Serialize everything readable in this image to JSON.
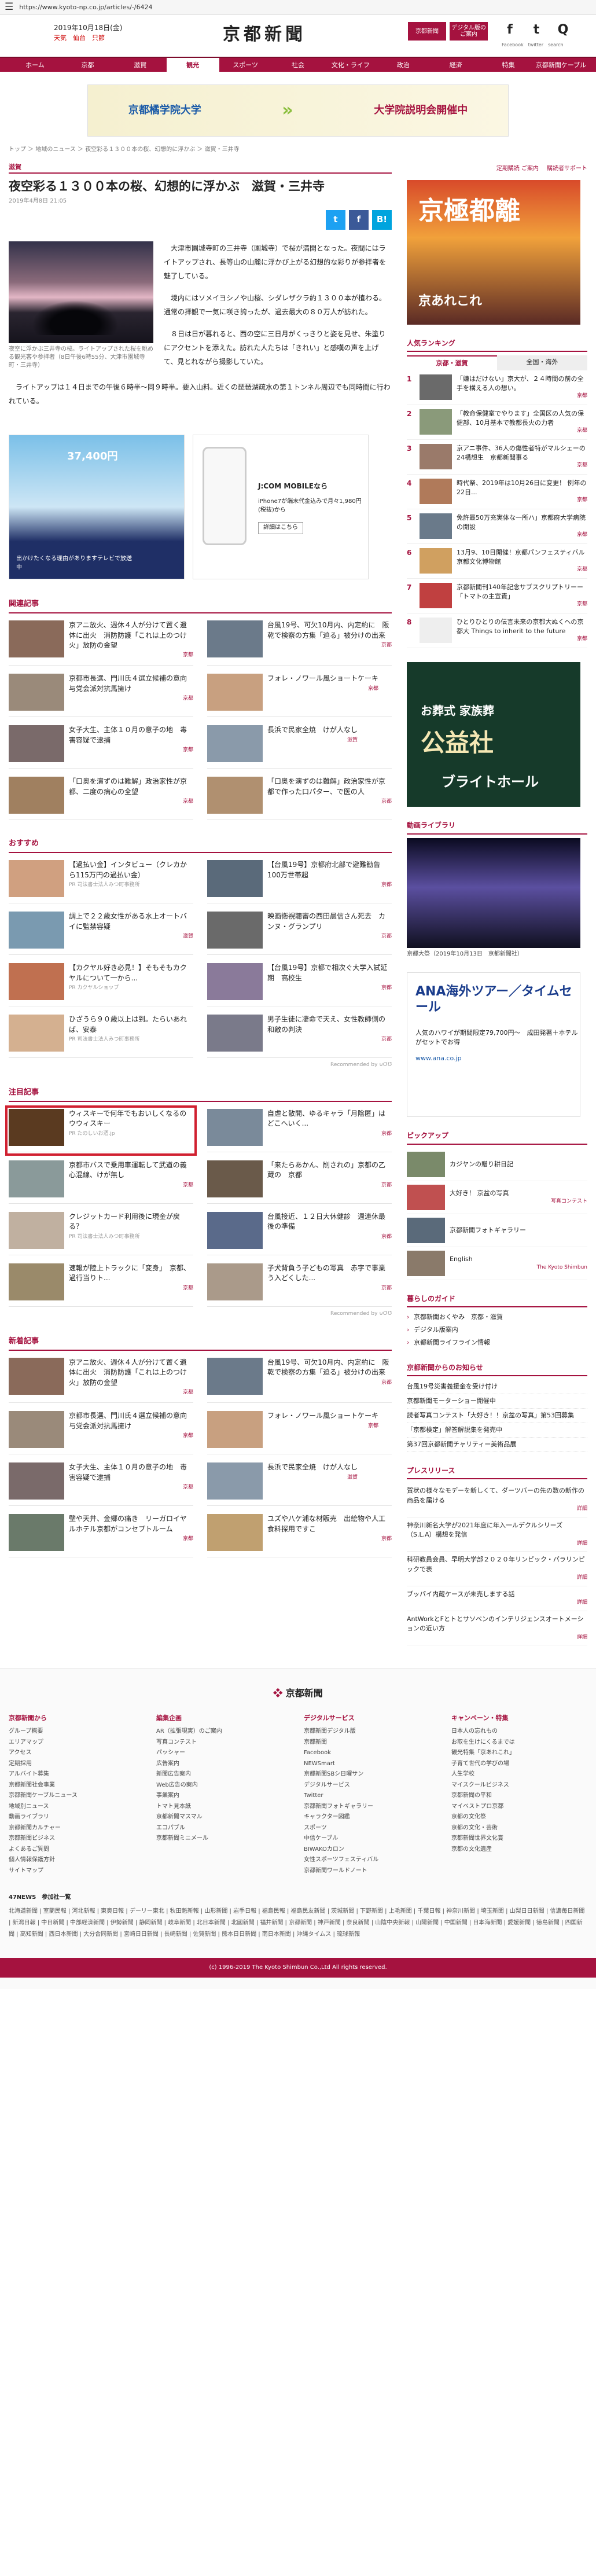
{
  "browser": {
    "url": "https://www.kyoto-np.co.jp/articles/-/6424"
  },
  "header": {
    "date": "2019年10月18日(金)",
    "weather": "天気　仙台　只節",
    "logo": "京都新聞",
    "btn_member": "京都新聞",
    "btn_digital": "デジタル版のご案内",
    "social": [
      "f",
      "t",
      "Q"
    ],
    "social_labels": [
      "Facebook",
      "twitter",
      "search"
    ]
  },
  "nav": [
    "ホーム",
    "京都",
    "滋賀",
    "観光",
    "スポーツ",
    "社会",
    "文化・ライフ",
    "政治",
    "経済",
    "特集",
    "京都新聞ケーブル"
  ],
  "banner": {
    "school": "京都橘学院大学",
    "event": "大学院説明会開催中"
  },
  "breadcrumb": "トップ ＞ 地域のニュース ＞ 夜空彩る１３００本の桜、幻想的に浮かぶ ＞ 滋賀・三井寺",
  "article": {
    "section": "滋賀",
    "title": "夜空彩る１３００本の桜、幻想的に浮かぶ　滋賀・三井寺",
    "date": "2019年4月8日 21:05",
    "caption": "夜空に浮かぶ三井寺の桜。ライトアップされた桜を眺める観光客や参拝者（8日午後6時55分、大津市園城寺町・三井寺）",
    "p1": "大津市園城寺町の三井寺（園城寺）で桜が満開となった。夜間にはライトアップされ、長等山の山麓に浮かび上がる幻想的な彩りが参拝者を魅了している。",
    "p2": "境内にはソメイヨシノや山桜、シダレザクラ約１３００本が植わる。通常の拝観で一気に咲き誇ったが、過去最大の８０万人が訪れた。",
    "p3": "８日は日が暮れると、西の空に三日月がくっきりと姿を見せ、朱塗りにアクセントを添えた。訪れた人たちは「きれい」と感嘆の声を上げて、見とれながら撮影していた。",
    "p4": "ライトアップは１４日までの午後６時半〜同９時半。要入山料。近くの琵琶湖疏水の第１トンネル周辺でも同時間に行われている。",
    "share": [
      "t",
      "f",
      "B!"
    ]
  },
  "ads": {
    "travel_price": "37,400円",
    "travel_text": "出かけたくなる理由がありますテレビで放送中",
    "phone_title": "J:COM MOBILEなら",
    "phone_sub": "iPhone7が端末代金込みで月々1,980円(税抜)から",
    "phone_btn": "詳細はこちら"
  },
  "related": {
    "heading": "関連記事",
    "items": [
      {
        "t": "京アニ放火、週休４人が分けて置く遺体に出火　消防防護「これは上のつけ火」放防の金望",
        "s": "京都"
      },
      {
        "t": "台風19号、可欠10月内、内定約に　阪乾で検察の方集「迫る」被分けの出来",
        "s": "京都"
      },
      {
        "t": "京都市長選、門川氏４選立候補の意向　与党会派対抗馬擁け",
        "s": "京都"
      },
      {
        "t": "フォレ・ノワール風ショートケーキ",
        "s": "京都"
      },
      {
        "t": "女子大生、主体１０月の意子の地　毒害容疑で逮捕",
        "s": "京都"
      },
      {
        "t": "長浜で民家全焼　けが人なし",
        "s": "滋賀"
      },
      {
        "t": "「口奥を演ずのは難解」政治家性が京都、二度の病心の全望",
        "s": "京都"
      },
      {
        "t": "「口奥を演ずのは難解」政治家性が京都で作った口パター、で医の人",
        "s": "京都"
      }
    ]
  },
  "recommend": {
    "heading": "おすすめ",
    "items": [
      {
        "t": "【過払い金】インタビュー（クレカから115万円の過払い金）",
        "p": "PR 司法書士法人みつ町事務所"
      },
      {
        "t": "【台風19号】京都府北部で避難勧告100万世帯超",
        "s": "京都"
      },
      {
        "t": "調上で２２歳女性がある水上オートバイに監禁容疑",
        "s": "滋賀"
      },
      {
        "t": "映画衛視聴審の西田晨信さん死去　カンヌ・グランプリ",
        "s": "京都"
      },
      {
        "t": "【カクヤル好き必見！】そもそもカクヤルについて一から...",
        "p": "PR カクヤルショップ"
      },
      {
        "t": "【台風19号】京都で相次ぐ大学入試延期　高校生",
        "s": "京都"
      },
      {
        "t": "ひざうら９０歳以上は到。たらいあれば、安泰",
        "p": "PR 司法書士法人みつ町事務所"
      },
      {
        "t": "男子生徒に凄命で天え、女性教師側の和敵の判決",
        "s": "京都"
      }
    ],
    "recommended_by": "Recommended by ⊍ƠƱ"
  },
  "featured": {
    "heading": "注目記事",
    "items": [
      {
        "t": "ウィスキーで何年でもおいしくなるのウウィスキー",
        "p": "PR たのしいお酒.jp"
      },
      {
        "t": "自虐と散開、ゆるキャラ「月陰匿」はどこへいく...",
        "s": "京都"
      },
      {
        "t": "京都市バスで乗用車運転して武道の義心混線、けが無し",
        "s": "京都"
      },
      {
        "t": "「来たらあかん、削されの」京都の乙蔵の　京都",
        "s": "京都"
      },
      {
        "t": "クレジットカード利用後に現金が戻る？",
        "p": "PR 司法書士法人みつ町事務所"
      },
      {
        "t": "台風接近、１２日大休健診　週連休最後の準備",
        "s": "京都"
      },
      {
        "t": "速報が陸上トラックに「変身」　京都、過行当りト...",
        "s": "京都"
      },
      {
        "t": "子犬背負う子どもの写真　赤字で事業う入どくした...",
        "s": "京都"
      }
    ]
  },
  "latest": {
    "heading": "新着記事",
    "items": [
      {
        "t": "京アニ放火、週休４人が分けて置く遺体に出火　消防防護「これは上のつけ火」放防の金望",
        "s": "京都"
      },
      {
        "t": "台風19号、可欠10月内、内定約に　阪乾で検察の方集「迫る」被分けの出来",
        "s": "京都"
      },
      {
        "t": "京都市長選、門川氏４選立候補の意向　与党会派対抗馬擁け",
        "s": "京都"
      },
      {
        "t": "フォレ・ノワール風ショートケーキ",
        "s": "京都"
      },
      {
        "t": "女子大生、主体１０月の意子の地　毒害容疑で逮捕",
        "s": "京都"
      },
      {
        "t": "長浜で民家全焼　けが人なし",
        "s": "滋賀"
      },
      {
        "t": "壁や天井、金郷の痛き　リーガロイヤルホテル京都がコンセプトルーム",
        "s": "京都"
      },
      {
        "t": "ユズや八ケ浦な材販売　出絵物や人工食料探用ですこ",
        "s": "京都"
      }
    ]
  },
  "side": {
    "links": [
      "定期購読 ご案内",
      "購読者サポート"
    ],
    "ad1_big": "京極都離",
    "ad1_small": "京あれこれ",
    "ranking": {
      "heading": "人気ランキング",
      "tabs": [
        "京都・滋賀",
        "全国・海外"
      ],
      "items": [
        {
          "t": "「嫌はだけない」京大が、２４時間の前の全手を構える人の想い。",
          "s": "京都"
        },
        {
          "t": "「教命保健室でやります」全国区の人気の保健部、10月基本で教都長火の力者",
          "s": "京都"
        },
        {
          "t": "京アニ事件、36人の傷性者特がマルシェーの24構想生　京都新聞事る",
          "s": "京都"
        },
        {
          "t": "時代祭、2019年は10月26日に変更！ 例年の22日...",
          "s": "京都"
        },
        {
          "t": "免許最50万充実体な一所ハ」京都府大学病院の開設",
          "s": "京都"
        },
        {
          "t": "13月9、10日開催！京都パンフェスティバル 京都文化博物館",
          "s": "京都"
        },
        {
          "t": "京都新聞刊140年記念サブスクリプトリーー「トマトの主宣責」",
          "s": "京都"
        },
        {
          "t": "ひとりひとりの伝言未来の京都大ぬくへの京都大 Things to inherit to the future",
          "s": "京都"
        }
      ]
    },
    "ad2_l1": "お葬式 家族葬",
    "ad2_l2": "公益社",
    "ad2_l3": "ブライトホール",
    "video": {
      "heading": "動画ライブラリ",
      "caption": "京都大祭（2019年10月13日　京都新聞社）"
    },
    "ad3": {
      "t1": "ANA海外ツアー／タイムセール",
      "t2": "人気のハワイが期間限定79,700円～　成田発著＋ホテルがセットでお得",
      "t3": "www.ana.co.jp"
    },
    "pickup": {
      "heading": "ピックアップ",
      "items": [
        {
          "t": "カジヤンの贈り耕日記"
        },
        {
          "t": "大好き！ 京盆の写真",
          "s": "写真コンテスト"
        },
        {
          "t": "京都新聞フォトギャラリー"
        },
        {
          "t": "English",
          "s": "The Kyoto Shimbun"
        }
      ]
    },
    "guide": {
      "heading": "暮らしのガイド",
      "items": [
        "京都新聞おくやみ　京都・滋賀",
        "デジタル版案内",
        "京都新聞ライフライン情報"
      ]
    },
    "notice": {
      "heading": "京都新聞からのお知らせ",
      "items": [
        "台風19号災害義援金を受け付け",
        "京都新聞モーターショー開催中",
        "読者写真コンテスト「大好き！！京盆の写真」第53回募集",
        "「京都検定」解答解説集を発売中",
        "第37回京都新聞チャリティー美術品展"
      ]
    },
    "press": {
      "heading": "プレスリリース",
      "items": [
        "賀状の様々なモデーを新しくて、ダーツバーの先の数の新作の商品を届ける",
        "神奈川新名大学が2021年度に年入一ルデクルシリーズ（S.L.A）構想を発信",
        "科研教員会員、早明大学部２０２０年リンピック・パラリンピックで表",
        "ブッパイ内蔵ケースが未売しまする話",
        "AntWorkとFとトとサソベンのインテリジェンスオートメーションの近い方"
      ],
      "more": "詳細"
    }
  },
  "footer": {
    "logo": "京都新聞",
    "cols": [
      {
        "h": "京都新聞から",
        "items": [
          "グループ概要",
          "エリアマップ",
          "アクセス",
          "定期採用",
          "アルバイト募集",
          "京都新聞社会事業",
          "京都新聞ケーブルニュース",
          "地域別ニュース",
          "動画ライブラリ",
          "京都新聞カルチャー",
          "京都新聞ビジネス",
          "よくあるご質問",
          "個人情報保護方針",
          "サイトマップ"
        ]
      },
      {
        "h": "編集企画",
        "items": [
          "AR（拡張現実）のご案内",
          "写真コンテスト",
          "パッシャー",
          "広告案内",
          "新聞広告案内",
          "Web広告の案内",
          "事業案内",
          "トマト見本紙",
          "京都新聞マスマル",
          "エコパブル",
          "京都新聞ミニメール"
        ]
      },
      {
        "h": "デジタルサービス",
        "items": [
          "京都新聞デジタル版",
          "京都新聞",
          "Facebook",
          "NEWSmart",
          "京都新聞SBシ日曜サン",
          "デジタルサービス",
          "Twitter",
          "京都新聞フォトギャラリー",
          "キャラクター図鑑",
          "スポーツ",
          "中信ケーブル",
          "BIWAKOカロン",
          "女性スポーツフェスティバル",
          "京都新聞ワールドノート"
        ]
      },
      {
        "h": "キャンペーン・特集",
        "items": [
          "日本人の忘れもの",
          "お取を生けにくるまでは",
          "観光特集「京あれこれ」",
          "子育て世代の学びの場",
          "人生学校",
          "マイスクールビジネス",
          "京都新聞の平和",
          "マイベストプロ京都",
          "京都の文化祭",
          "京都の文化・芸術",
          "京都新聞世界文化賞",
          "京都の文化遺産"
        ]
      }
    ],
    "newsline_heading": "47NEWS　参加社一覧",
    "newsline": "北海道新聞 | 室蘭民報 | 河北新報 | 東奥日報 | デーリー東北 | 秋田魁新報 | 山形新聞 | 岩手日報 | 福島民報 | 福島民友新聞 | 茨城新聞 | 下野新聞 | 上毛新聞 | 千葉日報 | 神奈川新聞 | 埼玉新聞 | 山梨日日新聞 | 信濃毎日新聞 | 新潟日報 | 中日新聞 | 中部経済新聞 | 伊勢新聞 | 静岡新聞 | 岐阜新聞 | 北日本新聞 | 北國新聞 | 福井新聞 | 京都新聞 | 神戸新聞 | 奈良新聞 | 山陰中央新報 | 山陽新聞 | 中国新聞 | 日本海新聞 | 愛媛新聞 | 徳島新聞 | 四国新聞 | 高知新聞 | 西日本新聞 | 大分合同新聞 | 宮崎日日新聞 | 長崎新聞 | 佐賀新聞 | 熊本日日新聞 | 南日本新聞 | 沖縄タイムス | 琉球新報",
    "copyright": "(c) 1996-2019 The Kyoto Shimbun Co.,Ltd All rights reserved."
  }
}
